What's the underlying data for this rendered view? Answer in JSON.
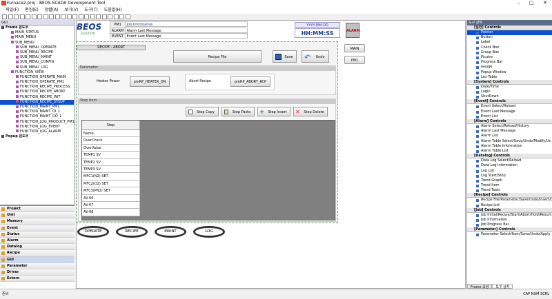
{
  "window": {
    "title": "Furnace2.proj - BEOS-SCADA Development Tool"
  },
  "menu": [
    "파일(F)",
    "편집(E)",
    "정렬(A)",
    "보기(V)",
    "도구(T)",
    "도움말(H)"
  ],
  "left_panel": {
    "header": "GUI",
    "tree": [
      {
        "label": "Frame 윈도우",
        "bold": true
      },
      {
        "label": "MAIN_STATUS"
      },
      {
        "label": "MAIN_MENU"
      },
      {
        "label": "SUB_MENU"
      },
      {
        "label": "SUB_MENU_OPERATE"
      },
      {
        "label": "SUB_MENU_RECIPE"
      },
      {
        "label": "SUB_MENU_MAINT"
      },
      {
        "label": "SUB_MENU_CONFIG"
      },
      {
        "label": "SUB_MENU_LOG"
      },
      {
        "label": "FUNCTION_VIEW"
      },
      {
        "label": "FUNCTION_OPERATE_MAIN"
      },
      {
        "label": "FUNCTION_OPERATE_PM1"
      },
      {
        "label": "FUNCTION_RECIPE_PROCESS"
      },
      {
        "label": "FUNCTION_RECIPE_ABORT"
      },
      {
        "label": "FUNCTION_RECIPE_INIT"
      },
      {
        "label": "FUNCTION_RECIPE_SYSUP",
        "selected": true
      },
      {
        "label": "FUNCTION_MAINT_PM1"
      },
      {
        "label": "FUNCTION_MAINT_DI_1"
      },
      {
        "label": "FUNCTION_MAINT_DO_1"
      },
      {
        "label": "FUNCTION_LOG_PRODUCT_PM1"
      },
      {
        "label": "FUNCTION_LOG_EVENT"
      },
      {
        "label": "FUNCTION_LOG_ALARM"
      },
      {
        "label": "Popup 윈도우",
        "bold": true
      }
    ]
  },
  "nav": [
    "Project",
    "Unit",
    "Memory",
    "Event",
    "Status",
    "Alarm",
    "Datalog",
    "Recipe",
    "GUI",
    "Parameter",
    "Driver",
    "Extern"
  ],
  "nav_active": "GUI",
  "screen": {
    "logo": "BEOS",
    "logo_sub": "SOLUTION",
    "info_rows": [
      [
        "PM1",
        "Job Information"
      ],
      [
        "ALARM",
        "Alarm Last Message"
      ],
      [
        "EVENT",
        "Event Last Message"
      ]
    ],
    "date": "YYYY-MM-DD",
    "time": "HH:MM:SS",
    "alarm_btn": "ALARM",
    "side_buttons": [
      "MAIN",
      "PM1"
    ],
    "recipe_title": "RECIPE - ABORT",
    "recipe_file": "Recipe File",
    "save": "Save",
    "undo": "Undo",
    "param_section": "Parameter",
    "heater_label": "Heater Power",
    "heater_value": "pmRP_HEATER_ON",
    "abort_label": "Abort Recipe",
    "abort_value": "pmRP_ABORT_RCP",
    "step_section": "Step Item",
    "step_copy": "Step Copy",
    "step_paste": "Step Paste",
    "step_insert": "Step Insert",
    "step_delete": "Step Delete",
    "step_header": "Step",
    "step_rows": [
      "Name",
      "OverCheck",
      "OverValue",
      "TEMP1 SV",
      "TEMP2 SV",
      "TEMP3 SV",
      "MFC1(N2) SET",
      "MFC2(O2) SET",
      "MFC3(PN2) SET",
      "AV-06",
      "AV-07",
      "AV-08"
    ],
    "bottom_buttons": [
      "OPERATE",
      "RECIPE",
      "MAINT",
      "LOG"
    ]
  },
  "right_panel": {
    "title": "도구 상자",
    "groups": [
      {
        "name": "[일반] Controls",
        "items": [
          "Pointer",
          "Button",
          "Label",
          "Check Box",
          "Group Box",
          "Picutre",
          "Progress Bar",
          "Gauge",
          "Popup Window",
          "List Table"
        ]
      },
      {
        "name": "[System] Controls",
        "items": [
          "Date/Time",
          "Login",
          "ShutDown"
        ]
      },
      {
        "name": "[Event] Controls",
        "items": [
          "Event Select/Reload",
          "Event Last Message",
          "Event List"
        ]
      },
      {
        "name": "[Alarm] Controls",
        "items": [
          "Alarm Select/Reload/History",
          "Alarm Last Message",
          "Alarm List",
          "Alarm Table Select/Save/Undo/Modify/Un",
          "Alarm Table Information",
          "Alarm Table List"
        ]
      },
      {
        "name": "[Datalog] Controls",
        "items": [
          "Data Log Select/Reload",
          "Data Log Information",
          "Log List",
          "Log Start/Stop",
          "Trend Graph",
          "Trend Item",
          "Trend Tools"
        ]
      },
      {
        "name": "[Recipe] Controls",
        "items": [
          "Recipe File/Parameter/Save/Undo/Insert/C",
          "Recipe List"
        ]
      },
      {
        "name": "[Job] Controls",
        "items": [
          "Job Initial/Recipe/Start/Abort/Hold/Resum",
          "Job Information",
          "Job Progress Bar"
        ]
      },
      {
        "name": "[Parameter] Controls",
        "items": [
          "Parameter Select/Item/Save/Undo/Apply"
        ]
      }
    ],
    "tabs": [
      "Frame 속성",
      "도구 상자"
    ]
  },
  "status": {
    "left": "준비",
    "right": "CAP  NUM  SCRL"
  }
}
